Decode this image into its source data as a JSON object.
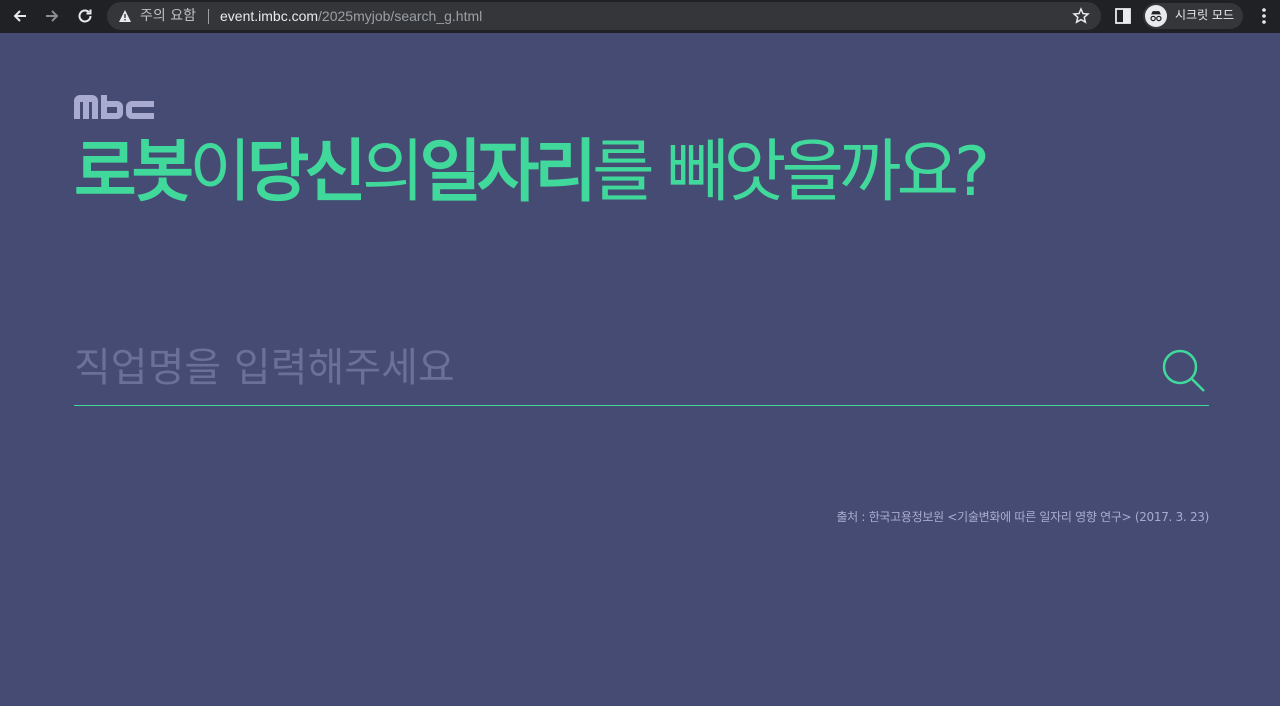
{
  "browser": {
    "security_warning": "주의 요함",
    "url_host": "event.imbc.com",
    "url_path": "/2025myjob/search_g.html",
    "incognito_label": "시크릿 모드"
  },
  "logo": {
    "text": "MBC"
  },
  "headline": {
    "parts": [
      {
        "text": "로봇",
        "style": "bold"
      },
      {
        "text": "이",
        "style": "thin"
      },
      {
        "text": "당신",
        "style": "bold"
      },
      {
        "text": "의",
        "style": "thin"
      },
      {
        "text": "일자리",
        "style": "bold"
      },
      {
        "text": "를 빼앗을까요?",
        "style": "thin"
      }
    ]
  },
  "search": {
    "placeholder": "직업명을 입력해주세요",
    "value": ""
  },
  "source": "출처 : 한국고용정보원 <기술변화에 따른 일자리 영향 연구> (2017. 3. 23)",
  "colors": {
    "background": "#464b73",
    "accent": "#41d99b",
    "chrome": "#202124"
  }
}
